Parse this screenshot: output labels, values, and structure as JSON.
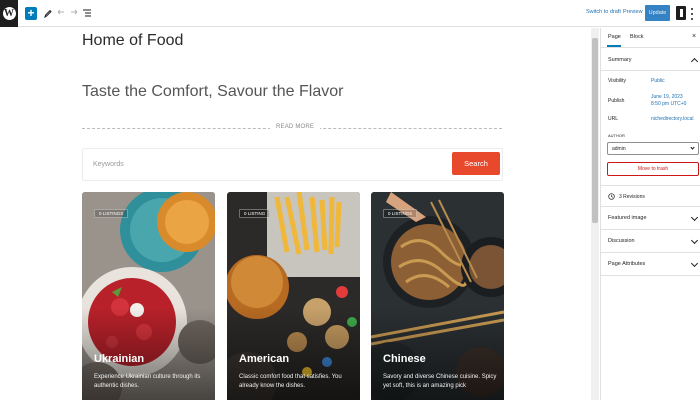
{
  "toolbar": {
    "logo_glyph": "W",
    "add_label": "+",
    "switch_to_draft": "Switch to draft",
    "preview": "Preview",
    "update": "Update",
    "icons": [
      "wordpress-logo-icon",
      "plus-icon",
      "pencil-icon",
      "undo-icon",
      "redo-icon",
      "list-view-icon",
      "settings-icon",
      "more-icon"
    ]
  },
  "content": {
    "site_title": "Home of Food",
    "tagline": "Taste the Comfort, Savour the Flavor",
    "read_more": "READ MORE",
    "search_placeholder": "Keywords",
    "search_button": "Search"
  },
  "cards": [
    {
      "badge": "0 LISTINGS",
      "title": "Ukrainian",
      "desc": "Experience Ukrainian culture through its authentic dishes."
    },
    {
      "badge": "0 LISTING",
      "title": "American",
      "desc": "Classic comfort food that satisfies. You already know the dishes."
    },
    {
      "badge": "0 LISTINGS",
      "title": "Chinese",
      "desc": "Savory and diverse Chinese cuisine. Spicy yet soft, this is an amazing pick"
    }
  ],
  "sidebar": {
    "tabs": [
      "Page",
      "Block"
    ],
    "close": "×",
    "summary_title": "Summary",
    "visibility_label": "Visibility",
    "visibility_value": "Public",
    "publish_label": "Publish",
    "publish_value_line1": "June 19, 2023",
    "publish_value_line2": "8:50 pm UTC+0",
    "url_label": "URL",
    "url_value": "nichedirectory.local",
    "author_label": "AUTHOR",
    "author_value": "admin",
    "trash_label": "Move to trash",
    "revisions": "3 Revisions",
    "panels": [
      "Featured image",
      "Discussion",
      "Page Attributes"
    ]
  },
  "colors": {
    "accent": "#007cba",
    "search_button": "#e8492c",
    "trash": "#cc1818"
  }
}
